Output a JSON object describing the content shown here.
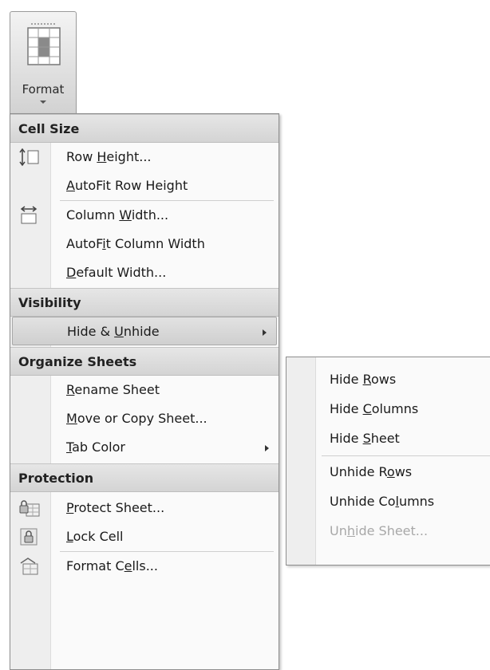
{
  "ribbon": {
    "format_label": "Format",
    "format_icon": "format-grid-icon"
  },
  "menu": {
    "sections": {
      "cell_size": "Cell Size",
      "visibility": "Visibility",
      "organize": "Organize Sheets",
      "protection": "Protection"
    },
    "items": {
      "row_height": {
        "pre": "Row ",
        "u": "H",
        "post": "eight..."
      },
      "autofit_row": {
        "pre": "",
        "u": "A",
        "post": "utoFit Row Height"
      },
      "col_width": {
        "pre": "Column ",
        "u": "W",
        "post": "idth..."
      },
      "autofit_col": {
        "pre": "AutoF",
        "u": "i",
        "post": "t Column Width"
      },
      "default_width": {
        "pre": "",
        "u": "D",
        "post": "efault Width..."
      },
      "hide_unhide": {
        "pre": "Hide & ",
        "u": "U",
        "post": "nhide"
      },
      "rename": {
        "pre": "",
        "u": "R",
        "post": "ename Sheet"
      },
      "move_copy": {
        "pre": "",
        "u": "M",
        "post": "ove or Copy Sheet..."
      },
      "tab_color": {
        "pre": "",
        "u": "T",
        "post": "ab Color"
      },
      "protect": {
        "pre": "",
        "u": "P",
        "post": "rotect Sheet..."
      },
      "lock_cell": {
        "pre": "",
        "u": "L",
        "post": "ock Cell"
      },
      "format_cells": {
        "pre": "Format C",
        "u": "e",
        "post": "lls..."
      }
    }
  },
  "submenu": {
    "hide_rows": {
      "pre": "Hide ",
      "u": "R",
      "post": "ows"
    },
    "hide_columns": {
      "pre": "Hide ",
      "u": "C",
      "post": "olumns"
    },
    "hide_sheet": {
      "pre": "Hide ",
      "u": "S",
      "post": "heet"
    },
    "unhide_rows": {
      "pre": "Unhide R",
      "u": "o",
      "post": "ws"
    },
    "unhide_columns": {
      "pre": "Unhide Co",
      "u": "l",
      "post": "umns"
    },
    "unhide_sheet": {
      "pre": "Un",
      "u": "h",
      "post": "ide Sheet..."
    }
  },
  "colors": {
    "highlight": "#d6d6d6",
    "disabled_text": "#a8a8a8"
  }
}
